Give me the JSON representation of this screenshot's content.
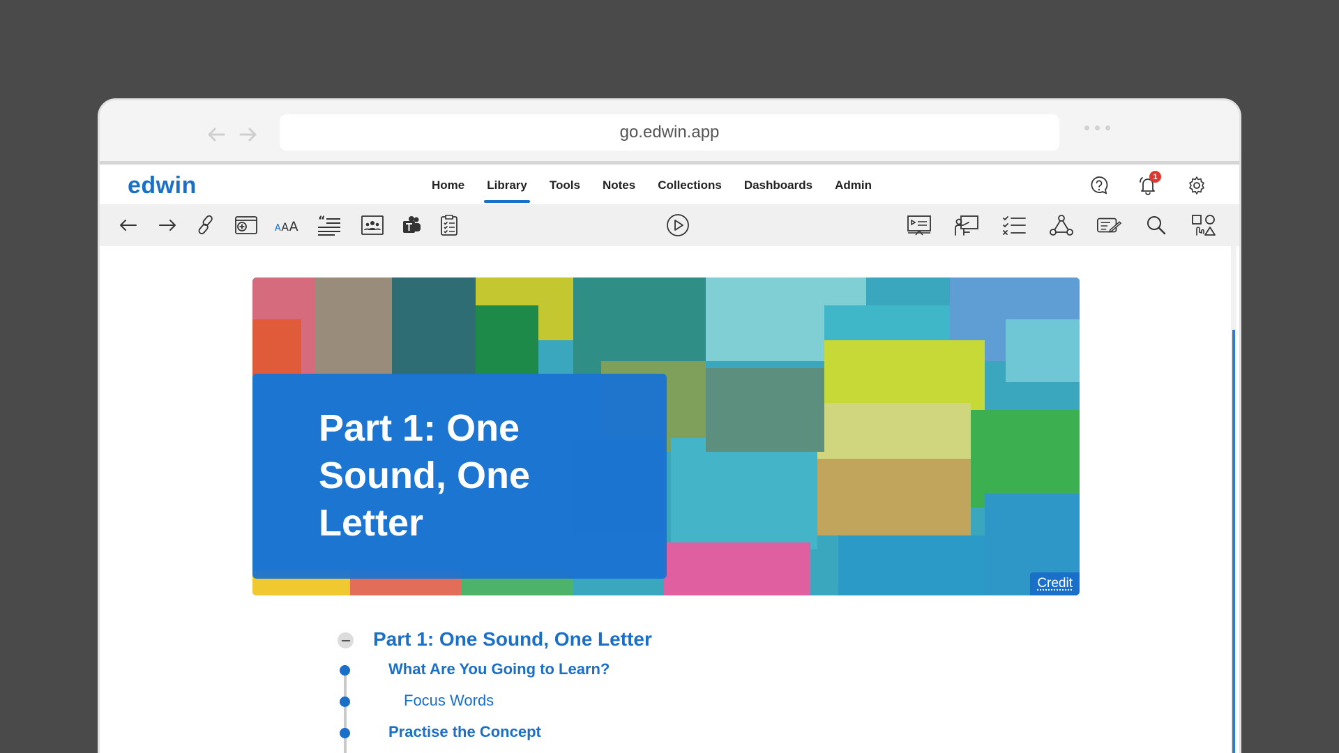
{
  "browser": {
    "url": "go.edwin.app",
    "back_icon": "arrow-left-icon",
    "forward_icon": "arrow-right-icon",
    "menu_icon": "more-dots-icon"
  },
  "app": {
    "logo": "edwin",
    "brand_color": "#1a6fc9",
    "nav": [
      {
        "label": "Home",
        "active": false
      },
      {
        "label": "Library",
        "active": true
      },
      {
        "label": "Tools",
        "active": false
      },
      {
        "label": "Notes",
        "active": false
      },
      {
        "label": "Collections",
        "active": false
      },
      {
        "label": "Dashboards",
        "active": false
      },
      {
        "label": "Admin",
        "active": false
      }
    ],
    "notifications_count": "1"
  },
  "toolbar": {
    "left": [
      "back-icon",
      "forward-icon",
      "link-icon",
      "add-resource-icon",
      "text-size-icon",
      "quote-list-icon",
      "image-people-icon",
      "teams-icon",
      "checklist-icon"
    ],
    "center": [
      "play-icon"
    ],
    "right": [
      "presentation-icon",
      "teacher-icon",
      "task-list-icon",
      "network-icon",
      "notes-pen-icon",
      "search-icon",
      "shapes-icon"
    ]
  },
  "hero": {
    "title": "Part 1: One Sound, One Letter",
    "credit": "Credit"
  },
  "toc": {
    "heading": "Part 1: One Sound, One Letter",
    "items": [
      {
        "label": "What Are You Going to Learn?",
        "bold": true
      },
      {
        "label": "Focus Words",
        "bold": false
      },
      {
        "label": "Practise the Concept",
        "bold": true
      }
    ]
  }
}
